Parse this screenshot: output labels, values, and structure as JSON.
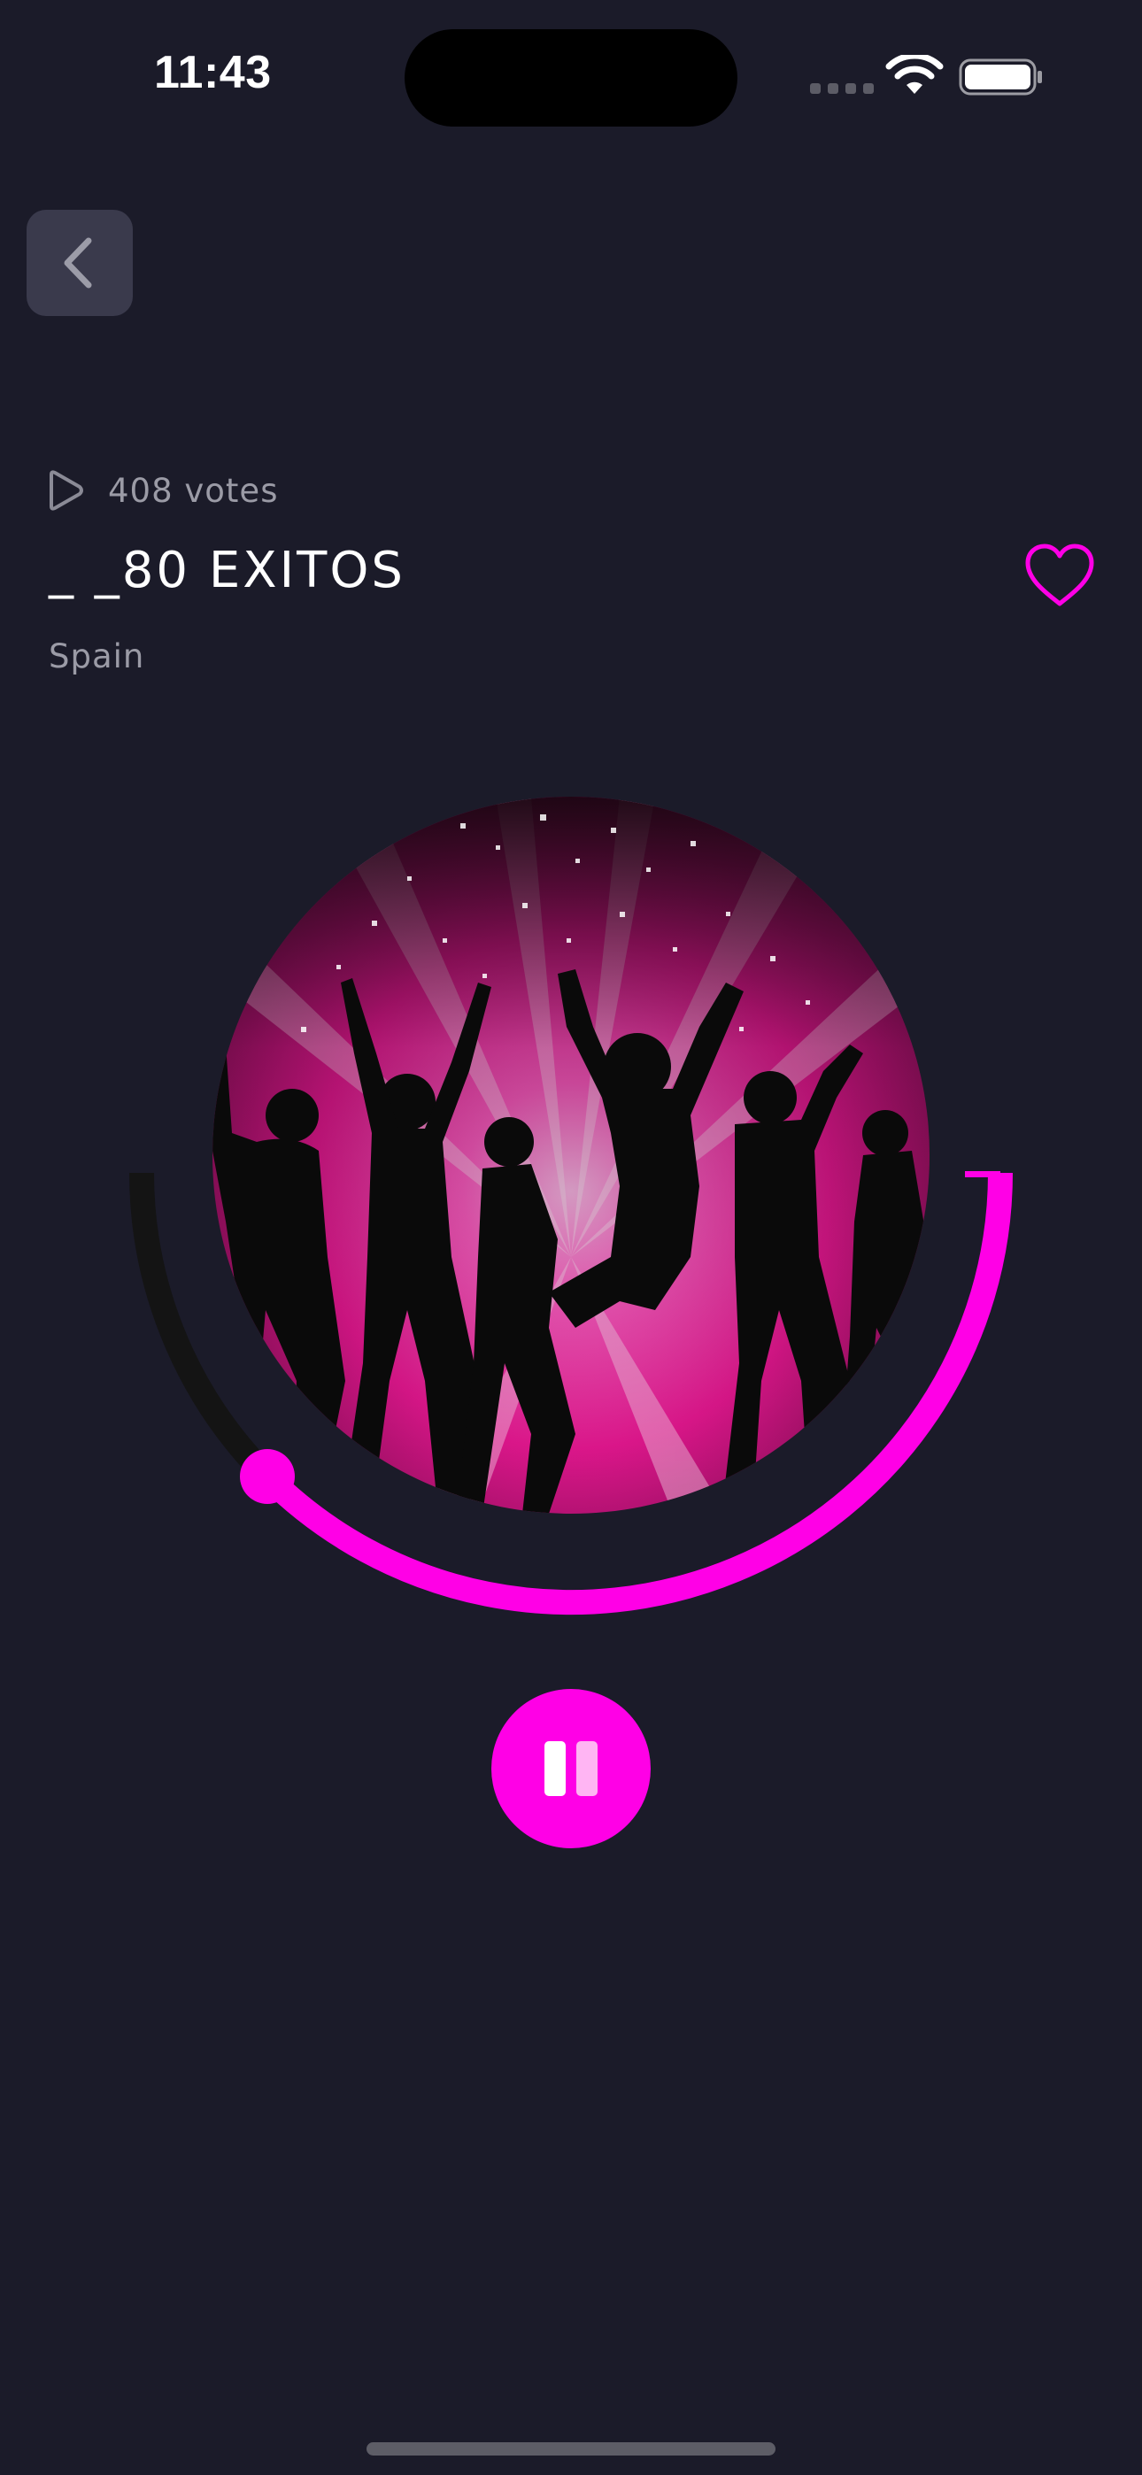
{
  "status_bar": {
    "time": "11:43"
  },
  "colors": {
    "background": "#1b1b29",
    "accent": "#ff00e6",
    "track": "#141414",
    "muted_text": "#9b9ba6"
  },
  "header": {
    "back_icon": "chevron-left-icon"
  },
  "station": {
    "votes": "408 votes",
    "votes_icon": "play-outline-icon",
    "title": "_ _80 EXITOS",
    "country": "Spain",
    "favorite_icon": "heart-outline-icon"
  },
  "player": {
    "artwork": "disco dancers silhouettes artwork",
    "progress_fraction": 0.65,
    "control_icon": "pause-icon",
    "state": "playing"
  }
}
